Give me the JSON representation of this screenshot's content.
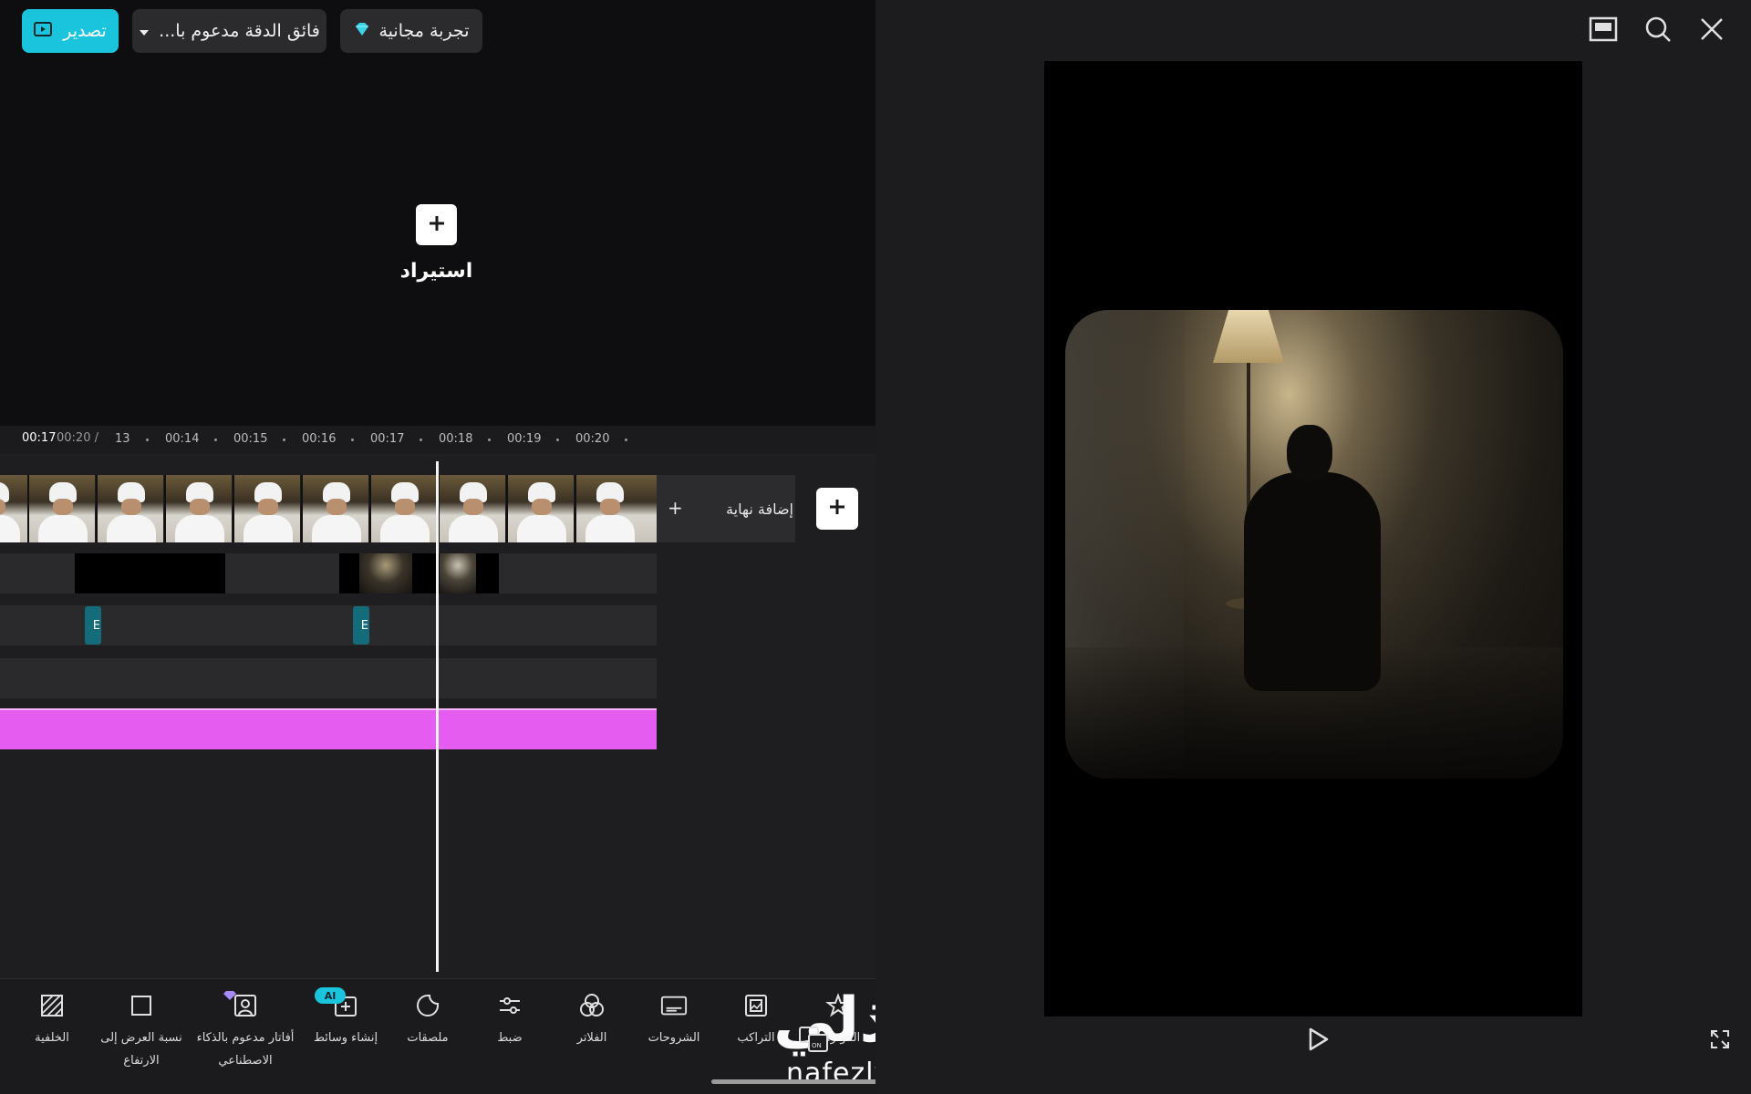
{
  "header": {
    "export_label": "تصدير",
    "quality_label": "فائق الدقة مدعوم با...",
    "trial_label": "تجربة مجانية"
  },
  "import": {
    "label": "استيراد"
  },
  "timeline": {
    "current_time": "00:17",
    "total_time": "00:20 /",
    "ticks": [
      "13",
      "00:14",
      "00:15",
      "00:16",
      "00:17",
      "00:18",
      "00:19",
      "00:20"
    ],
    "end_add_label": "إضافة نهاية",
    "audio_marker_label": "E"
  },
  "toolbar": {
    "items": [
      {
        "label": "الخلفية",
        "icon": "background-icon"
      },
      {
        "label": "نسبة العرض إلى الارتفاع",
        "icon": "aspect-ratio-icon"
      },
      {
        "label": "أفاتار مدعوم بالذكاء الاصطناعي",
        "icon": "ai-avatar-icon"
      },
      {
        "label": "إنشاء وسائط",
        "icon": "create-media-icon"
      },
      {
        "label": "ملصقات",
        "icon": "stickers-icon"
      },
      {
        "label": "ضبط",
        "icon": "adjust-icon"
      },
      {
        "label": "الفلاتر",
        "icon": "filters-icon"
      },
      {
        "label": "الشروحات",
        "icon": "captions-icon"
      },
      {
        "label": "التراكب",
        "icon": "overlay-icon"
      },
      {
        "label": "المؤثرات",
        "icon": "effects-icon"
      }
    ],
    "ai_badge": "AI"
  },
  "watermark": {
    "arabic": "نفذلي",
    "latin": "nafezly.com"
  },
  "colors": {
    "accent": "#19c4dc",
    "pink_track": "#e45cf0",
    "background": "#1c1c1e"
  }
}
